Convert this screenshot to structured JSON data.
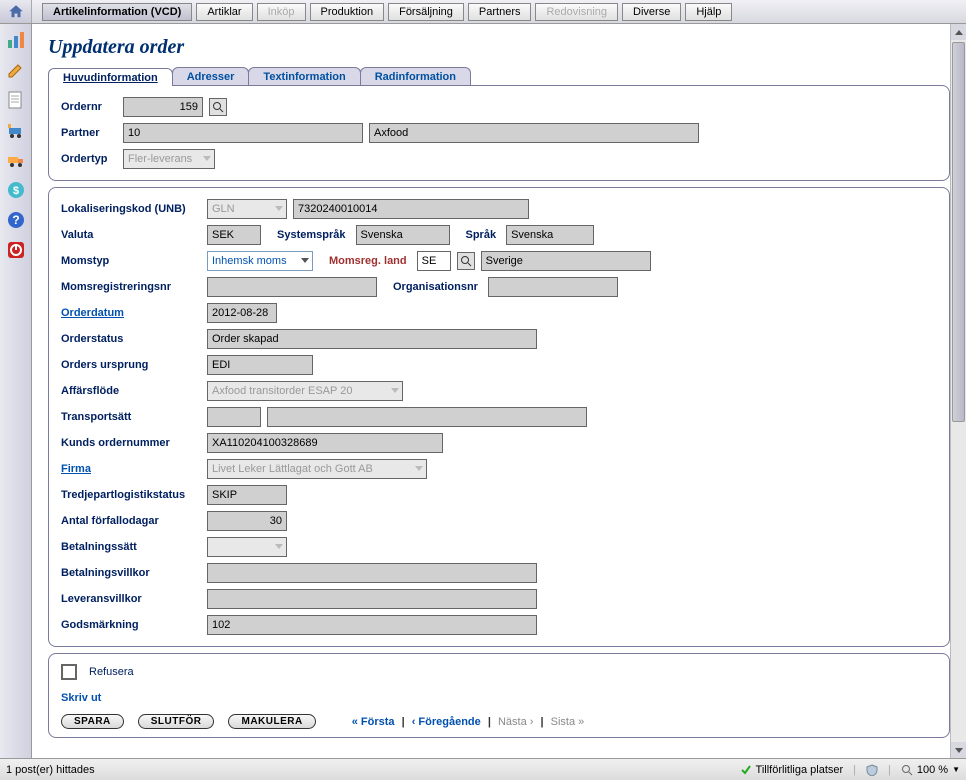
{
  "menu": {
    "items": [
      {
        "label": "Artikelinformation (VCD)",
        "active": true
      },
      {
        "label": "Artiklar"
      },
      {
        "label": "Inköp",
        "disabled": true
      },
      {
        "label": "Produktion"
      },
      {
        "label": "Försäljning"
      },
      {
        "label": "Partners"
      },
      {
        "label": "Redovisning",
        "disabled": true
      },
      {
        "label": "Diverse"
      },
      {
        "label": "Hjälp"
      }
    ]
  },
  "page_title": "Uppdatera order",
  "tabs": [
    "Huvudinformation",
    "Adresser",
    "Textinformation",
    "Radinformation"
  ],
  "active_tab": 0,
  "form": {
    "ordernr_label": "Ordernr",
    "ordernr": "159",
    "partner_label": "Partner",
    "partner_code": "10",
    "partner_name": "Axfood",
    "ordertyp_label": "Ordertyp",
    "ordertyp": "Fler-leverans",
    "lok_label": "Lokaliseringskod (UNB)",
    "lok_type": "GLN",
    "lok_value": "7320240010014",
    "valuta_label": "Valuta",
    "valuta": "SEK",
    "systemsprak_label": "Systemspråk",
    "systemsprak": "Svenska",
    "sprak_label": "Språk",
    "sprak": "Svenska",
    "momstyp_label": "Momstyp",
    "momstyp": "Inhemsk moms",
    "momsreg_label": "Momsreg. land",
    "momsreg_code": "SE",
    "momsreg_country": "Sverige",
    "momsregnr_label": "Momsregistreringsnr",
    "momsregnr": "",
    "orgnr_label": "Organisationsnr",
    "orgnr": "",
    "orderdatum_label": "Orderdatum",
    "orderdatum": "2012-08-28",
    "orderstatus_label": "Orderstatus",
    "orderstatus": "Order skapad",
    "ursprung_label": "Orders ursprung",
    "ursprung": "EDI",
    "affarsflode_label": "Affärsflöde",
    "affarsflode": "Axfood transitorder ESAP 20",
    "transport_label": "Transportsätt",
    "transport_code": "",
    "transport_desc": "",
    "kundorder_label": "Kunds ordernummer",
    "kundorder": "XA110204100328689",
    "firma_label": "Firma",
    "firma": "Livet Leker Lättlagat och Gott AB",
    "tpl_label": "Tredjepartlogistikstatus",
    "tpl": "SKIP",
    "forfall_label": "Antal förfallodagar",
    "forfall": "30",
    "betalsatt_label": "Betalningssätt",
    "betalsatt": "",
    "betalvillkor_label": "Betalningsvillkor",
    "betalvillkor": "",
    "leveransvillkor_label": "Leveransvillkor",
    "leveransvillkor": "",
    "godsmarkning_label": "Godsmärkning",
    "godsmarkning": "102"
  },
  "refusera_label": "Refusera",
  "skrivut": "Skriv ut",
  "buttons": {
    "spara": "SPARA",
    "slutfor": "SLUTFÖR",
    "makulera": "MAKULERA"
  },
  "nav": {
    "forsta": "« Första",
    "foreg": "‹ Föregående",
    "nasta": "Nästa ›",
    "sista": "Sista »"
  },
  "status": {
    "posts": "1 post(er) hittades",
    "trusted": "Tillförlitliga platser",
    "zoom": "100 %"
  }
}
